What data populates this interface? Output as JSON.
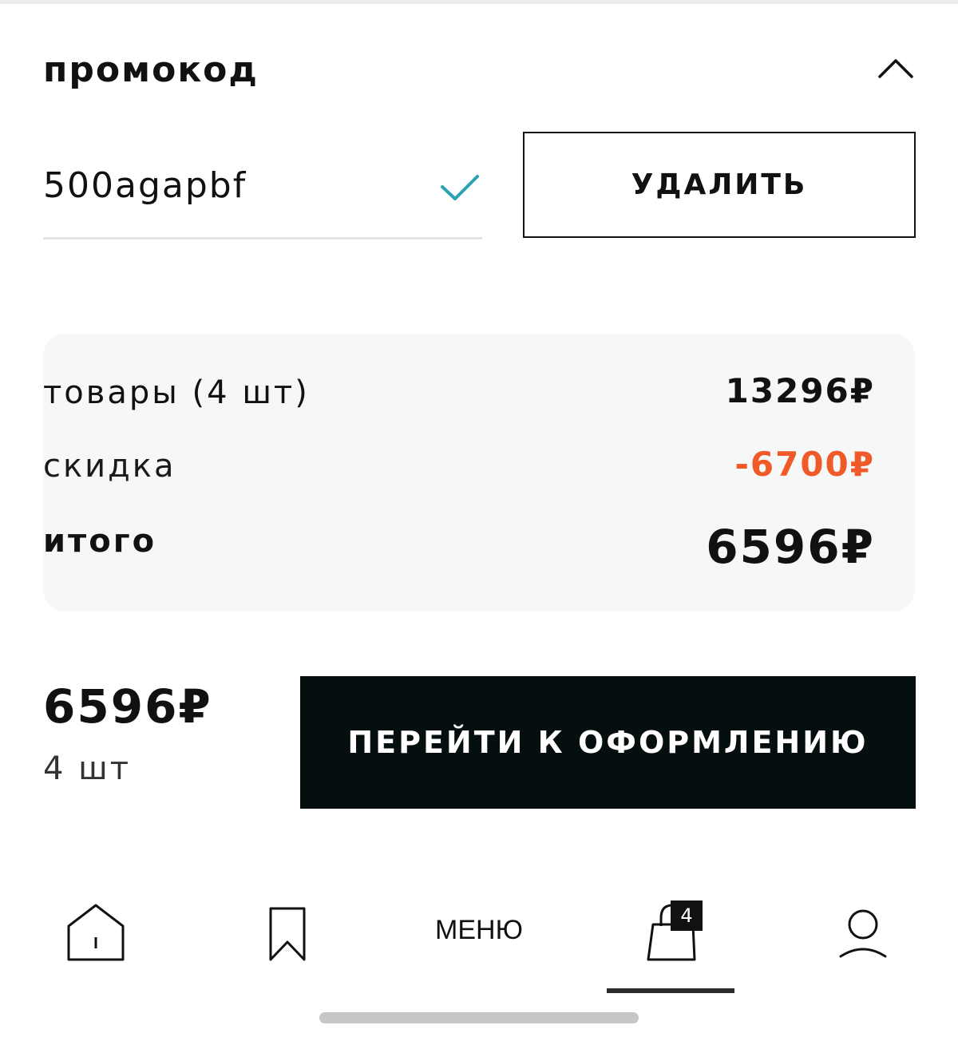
{
  "promo": {
    "title": "промокод",
    "code": "500agapbf",
    "delete_label": "УДАЛИТЬ"
  },
  "summary": {
    "items_label": "товары (4 шт)",
    "items_value": "13296₽",
    "discount_label": "скидка",
    "discount_value": "-6700₽",
    "total_label": "итого",
    "total_value": "6596₽"
  },
  "checkout": {
    "price": "6596₽",
    "quantity": "4 шт",
    "button_label": "ПЕРЕЙТИ К ОФОРМЛЕНИЮ"
  },
  "nav": {
    "items": [
      {
        "icon": "home-icon"
      },
      {
        "icon": "bookmark-icon"
      },
      {
        "label": "МЕНЮ"
      },
      {
        "icon": "shopping-bag-icon",
        "badge": "4"
      },
      {
        "icon": "profile-icon"
      }
    ],
    "active": "cart"
  },
  "colors": {
    "accent_check": "#2aa3b3",
    "discount": "#f05a28",
    "checkout_bg": "#050f0f",
    "card_bg": "#f6f7f7"
  }
}
